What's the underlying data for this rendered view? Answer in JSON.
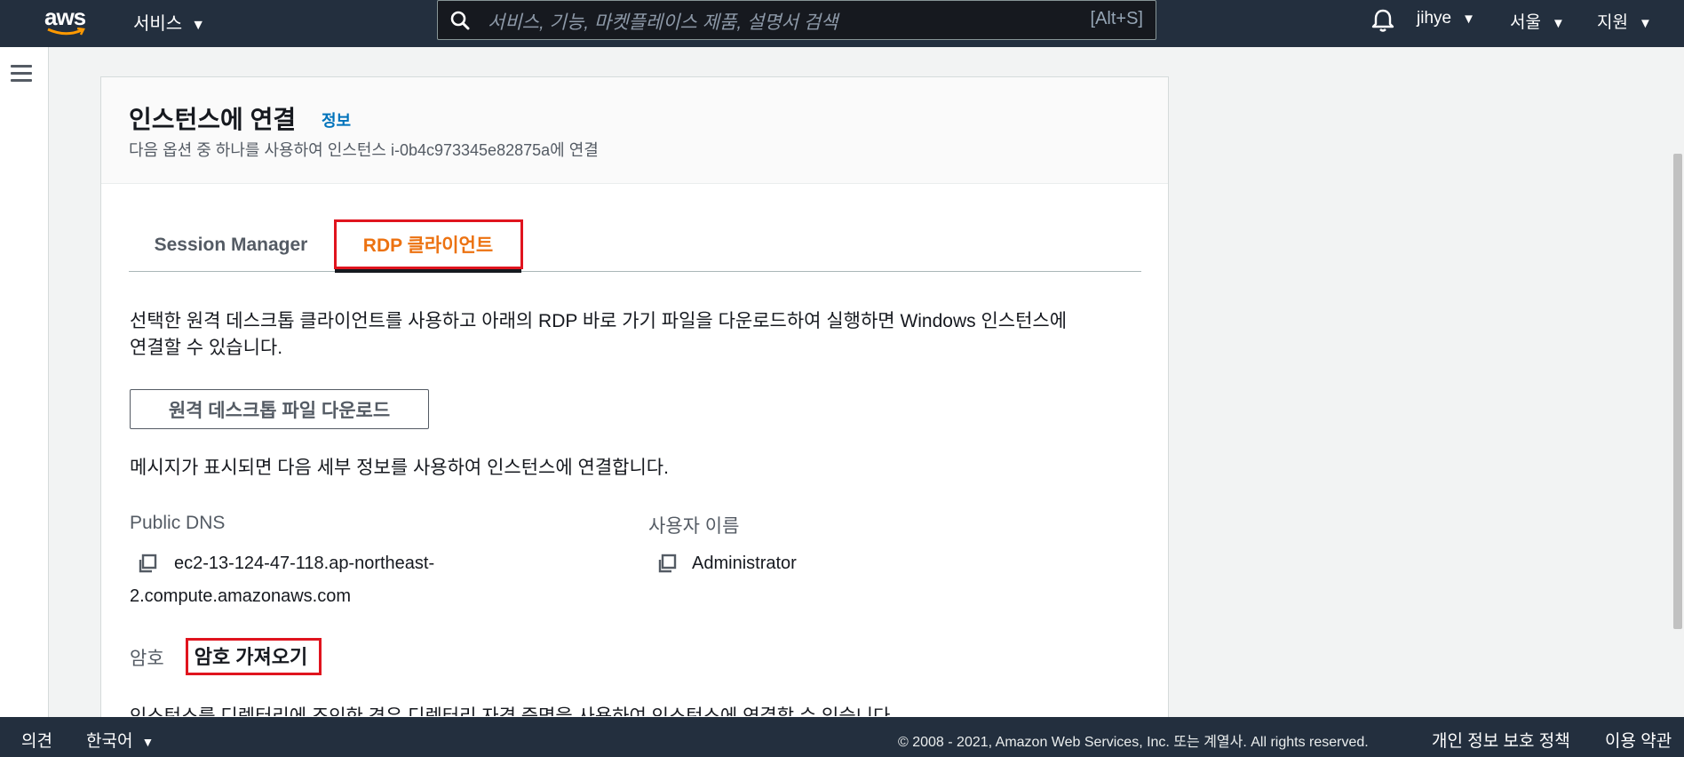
{
  "topnav": {
    "logo_text": "aws",
    "services_label": "서비스",
    "search_placeholder": "서비스, 기능, 마켓플레이스 제품, 설명서 검색",
    "search_shortcut": "[Alt+S]",
    "user_label": "jihye",
    "region_label": "서울",
    "support_label": "지원"
  },
  "panel": {
    "title": "인스턴스에 연결",
    "info_link": "정보",
    "description": "다음 옵션 중 하나를 사용하여 인스턴스 i-0b4c973345e82875a에 연결"
  },
  "tabs": [
    {
      "label": "Session Manager",
      "selected": false
    },
    {
      "label": "RDP 클라이언트",
      "selected": true
    }
  ],
  "rdp": {
    "intro_line1": "선택한 원격 데스크톱 클라이언트를 사용하고 아래의 RDP 바로 가기 파일을 다운로드하여 실행하면 Windows 인스턴스에",
    "intro_line2": "연결할 수 있습니다.",
    "download_button": "원격 데스크톱 파일 다운로드",
    "details_intro": "메시지가 표시되면 다음 세부 정보를 사용하여 인스턴스에 연결합니다.",
    "dns_label": "Public DNS",
    "dns_value_line1": "ec2-13-124-47-118.ap-northeast-",
    "dns_value_line2": "2.compute.amazonaws.com",
    "username_label": "사용자 이름",
    "username_value": "Administrator",
    "password_label": "암호",
    "password_button": "암호 가져오기",
    "cut_text": "인스턴스를 디렉터리에 조인한 경우 디렉터리 자격 증명을 사용하여 인스턴스에 연결할 수 있습니다."
  },
  "footer": {
    "feedback": "의견",
    "language": "한국어",
    "copyright": "© 2008 - 2021, Amazon Web Services, Inc. 또는 계열사. All rights reserved.",
    "privacy": "개인 정보 보호 정책",
    "terms": "이용 약관"
  },
  "colors": {
    "nav_bg": "#232f3e",
    "link": "#0073bb",
    "active_tab": "#ec7211",
    "highlight": "#e0141e"
  },
  "icons": [
    "search-icon",
    "bell-icon",
    "hamburger-menu-icon",
    "copy-icon",
    "caret-down-icon"
  ]
}
